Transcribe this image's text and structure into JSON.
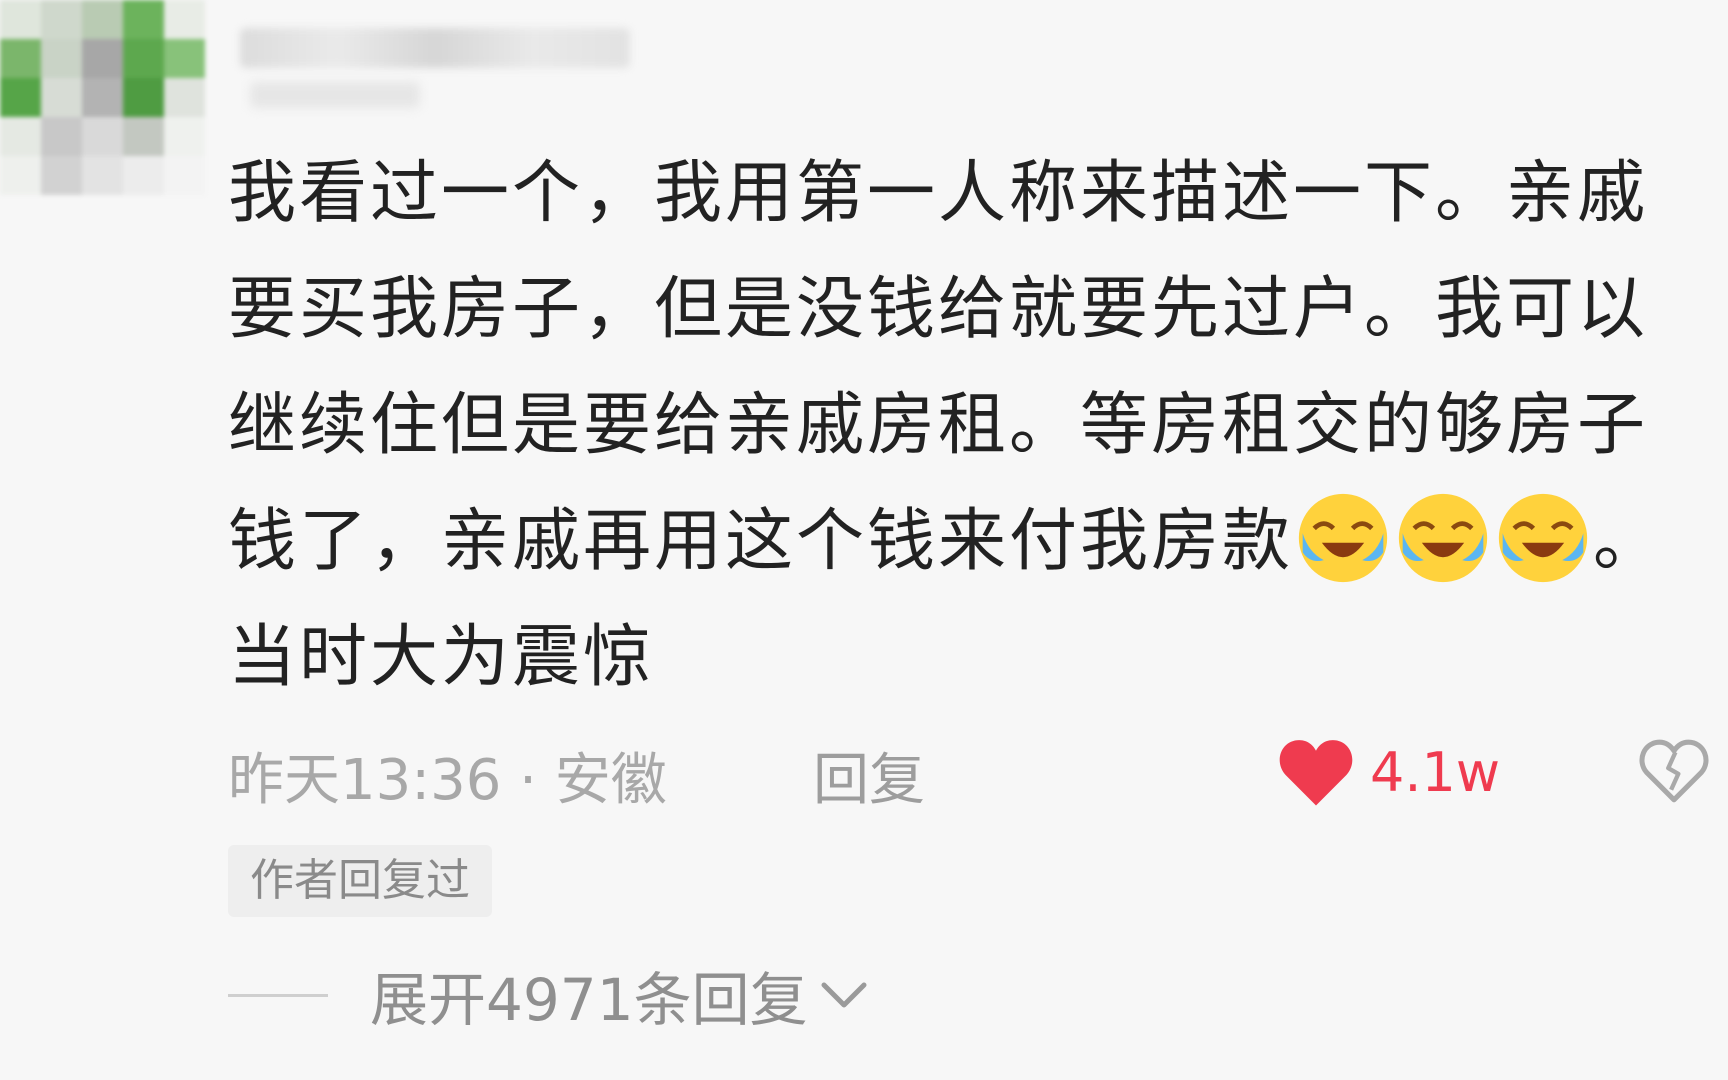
{
  "comment": {
    "text_part1": "我看过一个，我用第一人称来描述一下。亲戚要买我房子，但是没钱给就要先过户。我可以继续住但是要给亲戚房租。等房租交的够房子钱了，亲戚再用这个钱来付我房款",
    "emojis": [
      "laugh-cry-emoji",
      "laugh-cry-emoji",
      "laugh-cry-emoji"
    ],
    "text_part2": "。当时大为震惊"
  },
  "meta": {
    "time_location": "昨天13:36 · 安徽",
    "reply_label": "回复",
    "like_count": "4.1w",
    "like_color": "#ef3b4f"
  },
  "author_badge": "作者回复过",
  "expand_replies": "展开4971条回复",
  "icons": {
    "avatar": "avatar",
    "like": "heart-icon",
    "dislike": "broken-heart-icon",
    "expand": "chevron-down-icon"
  }
}
